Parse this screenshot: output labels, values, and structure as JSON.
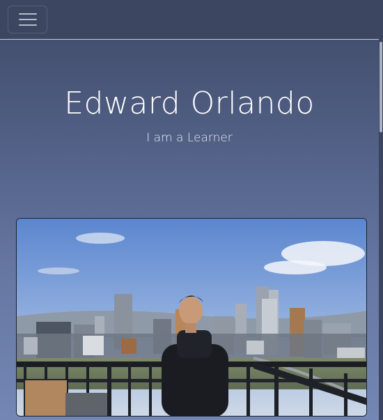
{
  "navbar": {
    "toggle_icon": "hamburger-icon"
  },
  "hero": {
    "name": "Edward Orlando",
    "tagline": "I am a Learner"
  },
  "photo": {
    "subject": "person-photo"
  },
  "colors": {
    "navbar_bg": "#3d4660",
    "page_gradient_top": "#3f4a66",
    "page_gradient_bottom": "#7486b3",
    "heading_text": "#ffffff"
  }
}
